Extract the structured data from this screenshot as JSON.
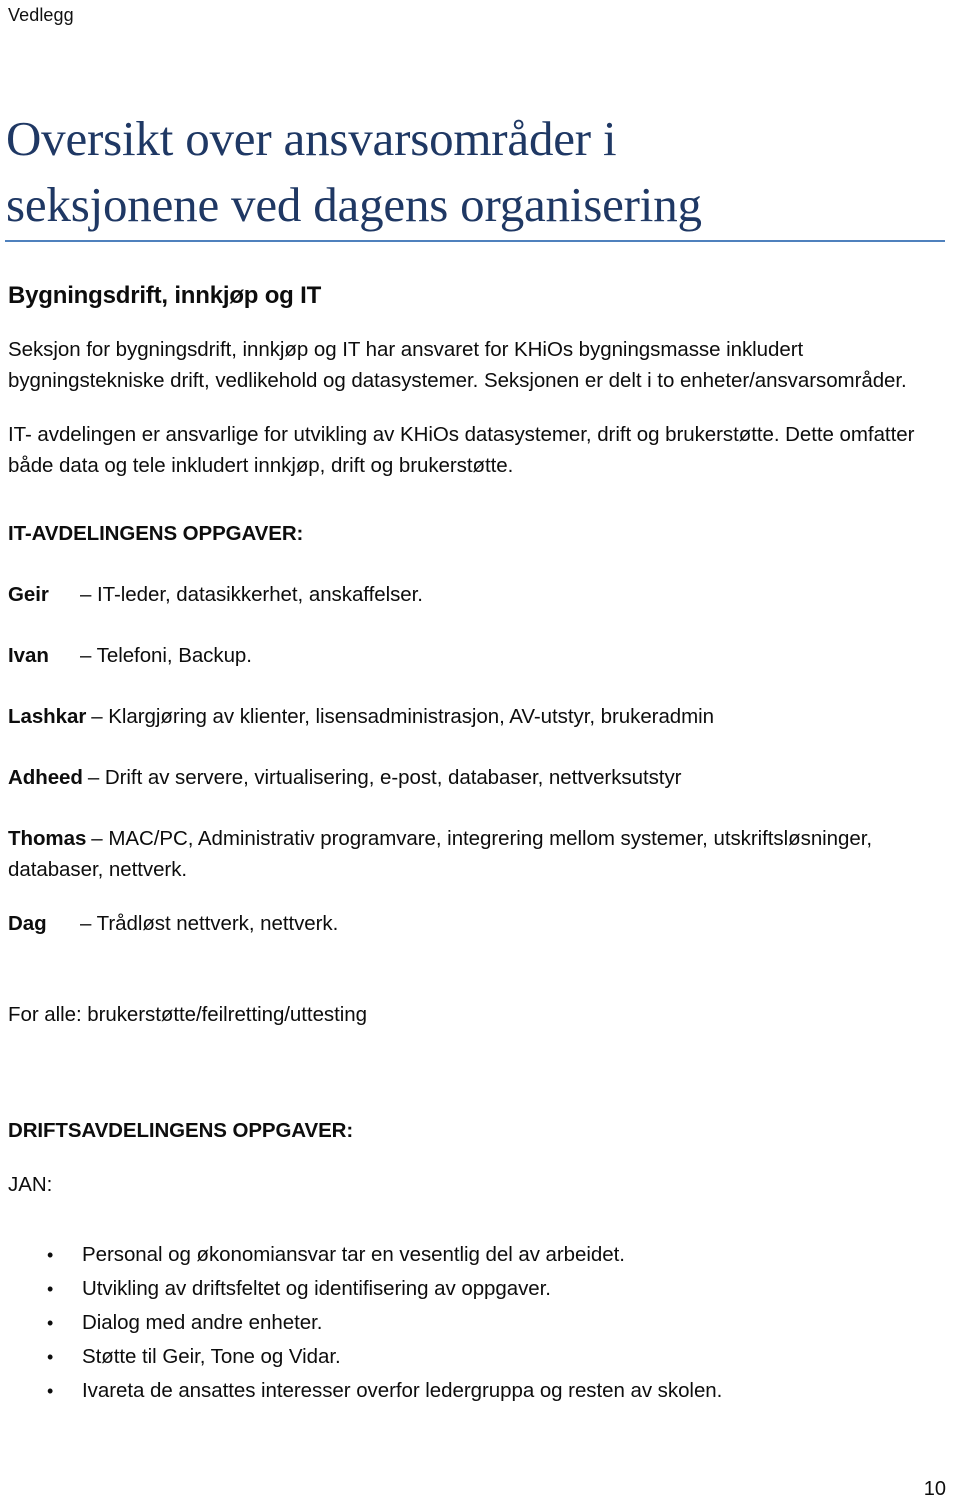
{
  "header": {
    "running_header": "Vedlegg",
    "page_number": "10"
  },
  "title": {
    "line1": "Oversikt over ansvarsområder i",
    "line2": "seksjonene ved dagens organisering",
    "color": "#1F3864",
    "rule_color": "#4F81BD"
  },
  "section": {
    "heading": "Bygningsdrift, innkjøp og IT",
    "paragraph1": "Seksjon for bygningsdrift, innkjøp og IT har ansvaret for KHiOs bygningsmasse inkludert bygningstekniske drift, vedlikehold og datasystemer. Seksjonen er delt i to enheter/ansvarsområder.",
    "paragraph2": "IT- avdelingen er ansvarlige for utvikling av KHiOs datasystemer, drift og brukerstøtte. Dette omfatter både data og tele inkludert innkjøp, drift og brukerstøtte."
  },
  "it_tasks": {
    "heading": "IT-AVDELINGENS OPPGAVER:",
    "people": [
      {
        "name": "Geir",
        "dash": "–",
        "desc": "IT-leder, datasikkerhet, anskaffelser.",
        "style": "tabbed"
      },
      {
        "name": "Ivan",
        "dash": "–",
        "desc": "Telefoni, Backup.",
        "style": "tabbed"
      },
      {
        "name": "Lashkar",
        "dash": "–",
        "desc": "Klargjøring av klienter, lisensadministrasjon, AV-utstyr, brukeradmin",
        "style": "inline"
      },
      {
        "name": "Adheed",
        "dash": "–",
        "desc": "Drift av servere, virtualisering, e-post, databaser, nettverksutstyr",
        "style": "inline"
      },
      {
        "name": "Thomas",
        "dash": "–",
        "desc": "MAC/PC, Administrativ programvare, integrering mellom systemer, utskriftsløsninger, databaser, nettverk.",
        "style": "inline"
      },
      {
        "name": "Dag",
        "dash": "–",
        "desc": "Trådløst nettverk, nettverk.",
        "style": "tabbed"
      }
    ],
    "footer_note": "For alle: brukerstøtte/feilretting/uttesting"
  },
  "drift_tasks": {
    "heading": "DRIFTSAVDELINGENS OPPGAVER:",
    "person_label": "JAN:",
    "bullet_glyph": "•",
    "bullets": [
      "Personal og økonomiansvar tar en vesentlig del av arbeidet.",
      "Utvikling av driftsfeltet og identifisering av oppgaver.",
      "Dialog med andre enheter.",
      "Støtte til Geir, Tone og Vidar.",
      "Ivareta de ansattes interesser overfor ledergruppa og resten av skolen."
    ]
  }
}
